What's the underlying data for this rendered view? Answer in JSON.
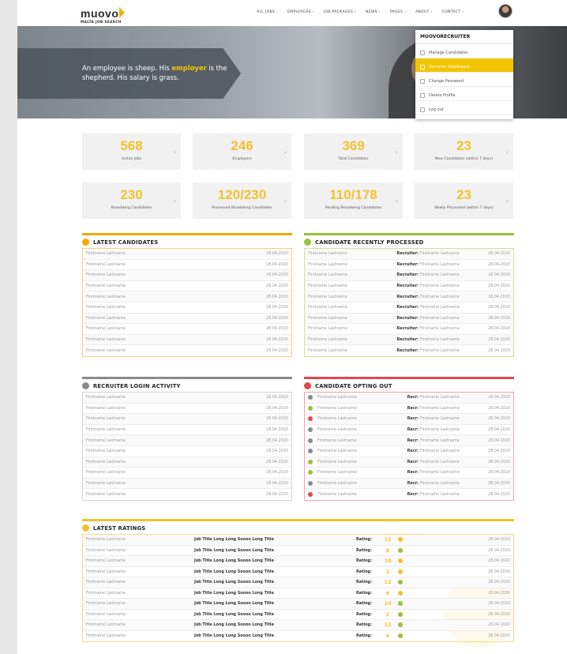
{
  "header": {
    "logo_word": "muovo",
    "logo_sub": "MALTA JOB SEARCH",
    "nav": [
      "ALL JOBS ›",
      "EMPLOYERS ›",
      "JOB PACKAGES ›",
      "NEWS ›",
      "PAGES ›",
      "ABOUT ›",
      "CONTACT ›"
    ]
  },
  "hero": {
    "quote_before": "An employee is sheep. His ",
    "quote_highlight": "employer",
    "quote_after": " is the shepherd. His salary is grass."
  },
  "dropdown": {
    "title": "MUOVORECRUITER",
    "items": [
      {
        "label": "Manage Candidates",
        "icon": "user-icon",
        "active": false
      },
      {
        "label": "Recruiter Dashboard",
        "icon": "dashboard-icon",
        "active": true
      },
      {
        "label": "Change Password",
        "icon": "lock-icon",
        "active": false
      },
      {
        "label": "Delete Profile",
        "icon": "trash-icon",
        "active": false
      },
      {
        "label": "Log out",
        "icon": "logout-icon",
        "active": false
      }
    ]
  },
  "stats": [
    {
      "value": "568",
      "label": "Active Jobs"
    },
    {
      "value": "246",
      "label": "Employers"
    },
    {
      "value": "369",
      "label": "Total Candidates"
    },
    {
      "value": "23",
      "label": "New Candidates (within 7 days)"
    },
    {
      "value": "230",
      "label": "Broadwing Candidates"
    },
    {
      "value": "120/230",
      "label": "Processed Broadwing Candidates"
    },
    {
      "value": "110/178",
      "label": "Pending Broadwing Candidates"
    },
    {
      "value": "23",
      "label": "Newly Processed (within 7 days)"
    }
  ],
  "latest_candidates": {
    "title": "LATEST CANDIDATES",
    "color": "#f2a900",
    "rows": [
      {
        "name": "Firstname Lastname",
        "date": "28.04.2020"
      },
      {
        "name": "Firstname Lastname",
        "date": "28.04.2020"
      },
      {
        "name": "Firstname Lastname",
        "date": "28.04.2020"
      },
      {
        "name": "Firstname Lastname",
        "date": "28.04.2020"
      },
      {
        "name": "Firstname Lastname",
        "date": "28.04.2020"
      },
      {
        "name": "Firstname Lastname",
        "date": "28.04.2020"
      },
      {
        "name": "Firstname Lastname",
        "date": "28.04.2020"
      },
      {
        "name": "Firstname Lastname",
        "date": "28.04.2020"
      },
      {
        "name": "Firstname Lastname",
        "date": "28.04.2020"
      },
      {
        "name": "Firstname Lastname",
        "date": "28.04.2020"
      }
    ]
  },
  "recently_processed": {
    "title": "CANDIDATE RECENTLY PROCESSED",
    "color": "#9cbf3b",
    "recruiter_label": "Recruiter:",
    "rows": [
      {
        "name": "Firstname Lastname",
        "recruiter": "Firstname Lastname",
        "date": "28.04.2020"
      },
      {
        "name": "Firstname Lastname",
        "recruiter": "Firstname Lastname",
        "date": "28.04.2020"
      },
      {
        "name": "Firstname Lastname",
        "recruiter": "Firstname Lastname",
        "date": "28.04.2020"
      },
      {
        "name": "Firstname Lastname",
        "recruiter": "Firstname Lastname",
        "date": "28.04.2020"
      },
      {
        "name": "Firstname Lastname",
        "recruiter": "Firstname Lastname",
        "date": "28.04.2020"
      },
      {
        "name": "Firstname Lastname",
        "recruiter": "Firstname Lastname",
        "date": "28.04.2020"
      },
      {
        "name": "Firstname Lastname",
        "recruiter": "Firstname Lastname",
        "date": "28.04.2020"
      },
      {
        "name": "Firstname Lastname",
        "recruiter": "Firstname Lastname",
        "date": "28.04.2020"
      },
      {
        "name": "Firstname Lastname",
        "recruiter": "Firstname Lastname",
        "date": "28.04.2020"
      },
      {
        "name": "Firstname Lastname",
        "recruiter": "Firstname Lastname",
        "date": "28.04.2020"
      }
    ]
  },
  "login_activity": {
    "title": "RECRUITER LOGIN ACTIVITY",
    "color": "#8a8a8a",
    "rows": [
      {
        "name": "Firstname Lastname",
        "date": "28.04.2020"
      },
      {
        "name": "Firstname Lastname",
        "date": "28.04.2020"
      },
      {
        "name": "Firstname Lastname",
        "date": "28.04.2020"
      },
      {
        "name": "Firstname Lastname",
        "date": "28.04.2020"
      },
      {
        "name": "Firstname Lastname",
        "date": "28.04.2020"
      },
      {
        "name": "Firstname Lastname",
        "date": "28.04.2020"
      },
      {
        "name": "Firstname Lastname",
        "date": "28.04.2020"
      },
      {
        "name": "Firstname Lastname",
        "date": "28.04.2020"
      },
      {
        "name": "Firstname Lastname",
        "date": "28.04.2020"
      },
      {
        "name": "Firstname Lastname",
        "date": "28.04.2020"
      }
    ]
  },
  "opting_out": {
    "title": "CANDIDATE OPTING OUT",
    "color": "#e0474c",
    "recruiter_label": "Recr:",
    "rows": [
      {
        "status": "#8a8a8a",
        "name": "Firstname Lastname",
        "recruiter": "Firstname Lastname",
        "date": "28.04.2020"
      },
      {
        "status": "#9cbf3b",
        "name": "Firstname Lastname",
        "recruiter": "Firstname Lastname",
        "date": "28.04.2020"
      },
      {
        "status": "#e0474c",
        "name": "Firstname Lastname",
        "recruiter": "Firstname Lastname",
        "date": "28.04.2020"
      },
      {
        "status": "#8a8a8a",
        "name": "Firstname Lastname",
        "recruiter": "Firstname Lastname",
        "date": "28.04.2020"
      },
      {
        "status": "#8a8a8a",
        "name": "Firstname Lastname",
        "recruiter": "Firstname Lastname",
        "date": "28.04.2020"
      },
      {
        "status": "#8a8a8a",
        "name": "Firstname Lastname",
        "recruiter": "Firstname Lastname",
        "date": "28.04.2020"
      },
      {
        "status": "#9cbf3b",
        "name": "Firstname Lastname",
        "recruiter": "Firstname Lastname",
        "date": "28.04.2020"
      },
      {
        "status": "#9cbf3b",
        "name": "Firstname Lastname",
        "recruiter": "Firstname Lastname",
        "date": "28.04.2020"
      },
      {
        "status": "#8a8a8a",
        "name": "Firstname Lastname",
        "recruiter": "Firstname Lastname",
        "date": "28.04.2020"
      },
      {
        "status": "#e0474c",
        "name": "Firstname Lastname",
        "recruiter": "Firstname Lastname",
        "date": "28.04.2020"
      }
    ]
  },
  "latest_ratings": {
    "title": "LATEST RATINGS",
    "color": "#f2c12e",
    "rating_label": "Rating:",
    "rows": [
      {
        "name": "Firstname Lastname",
        "job": "Job Title Long Long Soooo Long Title",
        "rating": "12",
        "status": "#f2c12e",
        "date": "28.04.2020"
      },
      {
        "name": "Firstname Lastname",
        "job": "Job Title Long Long Soooo Long Title",
        "rating": "6",
        "status": "#9cbf3b",
        "date": "28.04.2020"
      },
      {
        "name": "Firstname Lastname",
        "job": "Job Title Long Long Soooo Long Title",
        "rating": "10",
        "status": "#f2c12e",
        "date": "28.04.2020"
      },
      {
        "name": "Firstname Lastname",
        "job": "Job Title Long Long Soooo Long Title",
        "rating": "2",
        "status": "#f2c12e",
        "date": "28.04.2020"
      },
      {
        "name": "Firstname Lastname",
        "job": "Job Title Long Long Soooo Long Title",
        "rating": "12",
        "status": "#9cbf3b",
        "date": "28.04.2020"
      },
      {
        "name": "Firstname Lastname",
        "job": "Job Title Long Long Soooo Long Title",
        "rating": "6",
        "status": "#f2c12e",
        "date": "28.04.2020"
      },
      {
        "name": "Firstname Lastname",
        "job": "Job Title Long Long Soooo Long Title",
        "rating": "10",
        "status": "#9cbf3b",
        "date": "28.04.2020"
      },
      {
        "name": "Firstname Lastname",
        "job": "Job Title Long Long Soooo Long Title",
        "rating": "2",
        "status": "#9cbf3b",
        "date": "28.04.2020"
      },
      {
        "name": "Firstname Lastname",
        "job": "Job Title Long Long Soooo Long Title",
        "rating": "12",
        "status": "#9cbf3b",
        "date": "28.04.2020"
      },
      {
        "name": "Firstname Lastname",
        "job": "Job Title Long Long Soooo Long Title",
        "rating": "6",
        "status": "#9cbf3b",
        "date": "28.04.2020"
      }
    ]
  }
}
